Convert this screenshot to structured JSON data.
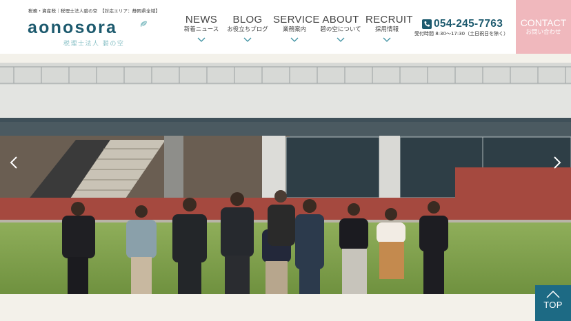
{
  "header": {
    "tagline": "税務・資産税｜税理士法人碧の空　【対応エリア：静岡県全域】",
    "logo_text": "aonosora",
    "logo_sub": "税理士法人 碧の空",
    "nav": [
      {
        "en": "NEWS",
        "jp": "新着ニュース"
      },
      {
        "en": "BLOG",
        "jp": "お役立ちブログ"
      },
      {
        "en": "SERVICE",
        "jp": "業務案内"
      },
      {
        "en": "ABOUT",
        "jp": "碧の空について"
      },
      {
        "en": "RECRUIT",
        "jp": "採用情報"
      }
    ],
    "phone": "054-245-7763",
    "hours": "受付時間 8:30〜17:30（土日祝日を除く）",
    "contact_en": "CONTACT",
    "contact_jp": "お問い合わせ"
  },
  "totop_label": "TOP",
  "colors": {
    "brand": "#1d5a6e",
    "contact": "#f0b8bd",
    "totop": "#1d6a84",
    "logo_sub": "#8dc3c8"
  },
  "icons": [
    "phone-icon",
    "chevron-down-icon",
    "arrow-left-icon",
    "arrow-right-icon",
    "chevron-up-icon",
    "leaf-icon"
  ]
}
